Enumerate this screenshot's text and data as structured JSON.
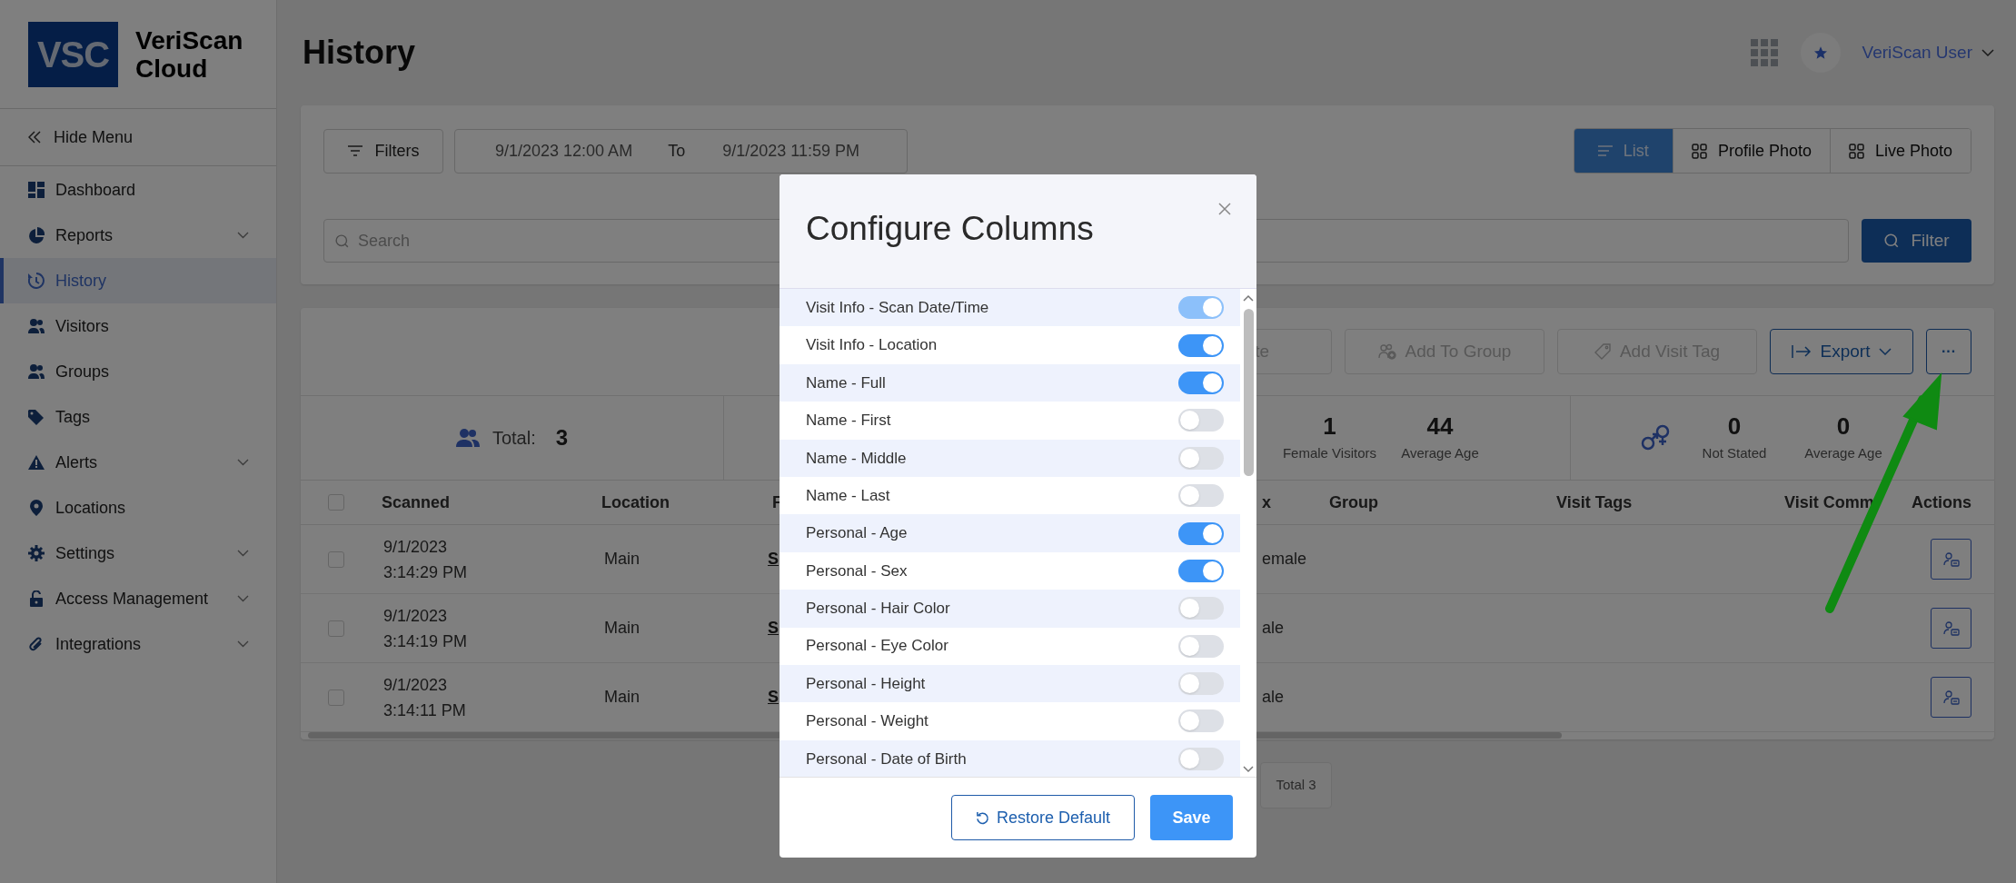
{
  "brand": {
    "logo": "VSC",
    "name": "VeriScan Cloud"
  },
  "sidebar": {
    "hide_menu": "Hide Menu",
    "items": [
      {
        "label": "Dashboard",
        "selected": false,
        "expandable": false
      },
      {
        "label": "Reports",
        "selected": false,
        "expandable": true
      },
      {
        "label": "History",
        "selected": true,
        "expandable": false
      },
      {
        "label": "Visitors",
        "selected": false,
        "expandable": false
      },
      {
        "label": "Groups",
        "selected": false,
        "expandable": false
      },
      {
        "label": "Tags",
        "selected": false,
        "expandable": false
      },
      {
        "label": "Alerts",
        "selected": false,
        "expandable": true
      },
      {
        "label": "Locations",
        "selected": false,
        "expandable": false
      },
      {
        "label": "Settings",
        "selected": false,
        "expandable": true
      },
      {
        "label": "Access Management",
        "selected": false,
        "expandable": true
      },
      {
        "label": "Integrations",
        "selected": false,
        "expandable": true
      }
    ]
  },
  "page_title": "History",
  "header": {
    "user": "VeriScan User"
  },
  "filters": {
    "button": "Filters",
    "date_from": "9/1/2023 12:00 AM",
    "to": "To",
    "date_to": "9/1/2023 11:59 PM",
    "views": [
      {
        "label": "List",
        "selected": true
      },
      {
        "label": "Profile Photo",
        "selected": false
      },
      {
        "label": "Live Photo",
        "selected": false
      }
    ],
    "search_placeholder": "Search",
    "filter_button": "Filter"
  },
  "toolbar": {
    "buttons": [
      {
        "label": "te",
        "disabled": true
      },
      {
        "label": "Add To Group",
        "disabled": true
      },
      {
        "label": "Add Visit Tag",
        "disabled": true
      },
      {
        "label": "Export",
        "disabled": false
      }
    ],
    "more": "···"
  },
  "stats": {
    "total_label": "Total:",
    "total": "3",
    "groups": [
      {
        "items": [
          {
            "value": "1",
            "label": "Female Visitors"
          },
          {
            "value": "44",
            "label": "Average Age"
          }
        ]
      },
      {
        "items": [
          {
            "value": "0",
            "label": "Not Stated"
          },
          {
            "value": "0",
            "label": "Average Age"
          }
        ]
      }
    ]
  },
  "table": {
    "all_checked": false,
    "columns": [
      "Scanned",
      "Location",
      "F",
      "x",
      "Group",
      "Visit Tags",
      "Visit Comm",
      "Actions"
    ],
    "rows": [
      {
        "checked": false,
        "scanned": "9/1/2023\n3:14:29 PM",
        "location": "Main",
        "column_3": "S",
        "column_4": "emale"
      },
      {
        "checked": false,
        "scanned": "9/1/2023\n3:14:19 PM",
        "location": "Main",
        "column_3": "S",
        "column_4": "ale"
      },
      {
        "checked": false,
        "scanned": "9/1/2023\n3:14:11 PM",
        "location": "Main",
        "column_3": "S",
        "column_4": "ale"
      }
    ]
  },
  "pagination": {
    "total": "Total 3"
  },
  "modal": {
    "title": "Configure Columns",
    "columns": [
      {
        "label": "Visit Info - Scan Date/Time",
        "on": true,
        "disabled": true
      },
      {
        "label": "Visit Info - Location",
        "on": true,
        "disabled": false
      },
      {
        "label": "Name - Full",
        "on": true,
        "disabled": false
      },
      {
        "label": "Name - First",
        "on": false,
        "disabled": false
      },
      {
        "label": "Name - Middle",
        "on": false,
        "disabled": false
      },
      {
        "label": "Name - Last",
        "on": false,
        "disabled": false
      },
      {
        "label": "Personal - Age",
        "on": true,
        "disabled": false
      },
      {
        "label": "Personal - Sex",
        "on": true,
        "disabled": false
      },
      {
        "label": "Personal - Hair Color",
        "on": false,
        "disabled": false
      },
      {
        "label": "Personal - Eye Color",
        "on": false,
        "disabled": false
      },
      {
        "label": "Personal - Height",
        "on": false,
        "disabled": false
      },
      {
        "label": "Personal - Weight",
        "on": false,
        "disabled": false
      },
      {
        "label": "Personal - Date of Birth",
        "on": false,
        "disabled": false
      }
    ],
    "restore": "Restore Default",
    "save": "Save"
  }
}
